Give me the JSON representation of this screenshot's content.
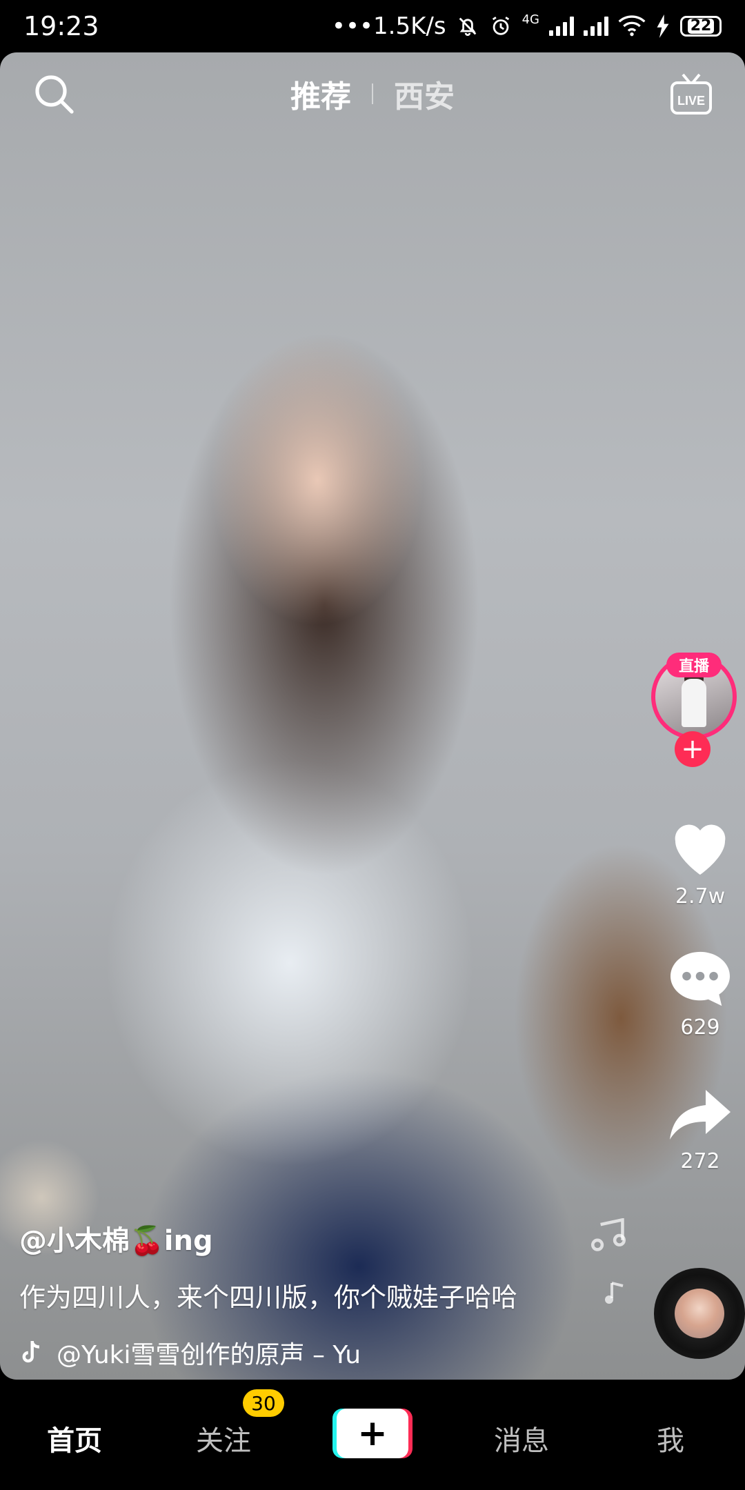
{
  "status_bar": {
    "time": "19:23",
    "net_speed": "•••1.5K/s",
    "network_type": "4G",
    "battery": "22"
  },
  "top_nav": {
    "tabs": [
      {
        "label": "推荐",
        "active": true
      },
      {
        "label": "西安",
        "active": false
      }
    ],
    "live_label": "LIVE"
  },
  "sidebar": {
    "live_badge": "直播",
    "follow_symbol": "+",
    "likes": "2.7w",
    "comments": "629",
    "shares": "272"
  },
  "caption": {
    "username": "@小木棉🍒ing",
    "description": "作为四川人，来个四川版，你个贼娃子哈哈",
    "music": "@Yuki雪雪创作的原声 – Yuki雪雪"
  },
  "bottom_nav": {
    "items": [
      "首页",
      "关注",
      "消息",
      "我"
    ],
    "follow_badge": "30",
    "create_symbol": "+"
  },
  "colors": {
    "accent_pink": "#fe2c55",
    "accent_cyan": "#25f4ee",
    "badge_yellow": "#ffcc00"
  }
}
